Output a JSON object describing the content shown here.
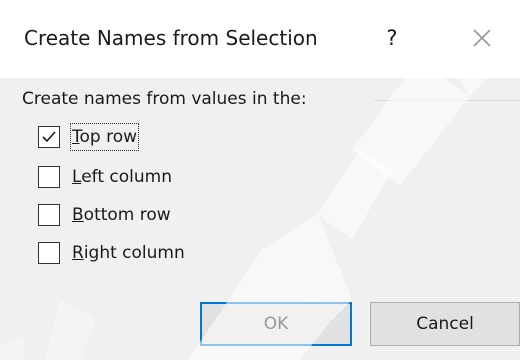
{
  "dialog": {
    "title": "Create Names from Selection",
    "help_label": "?",
    "close_icon": "close-icon"
  },
  "group": {
    "label": "Create names from values in the:"
  },
  "options": [
    {
      "mnemonic": "T",
      "rest": "op row",
      "checked": true
    },
    {
      "mnemonic": "L",
      "rest": "eft column",
      "checked": false
    },
    {
      "mnemonic": "B",
      "rest": "ottom row",
      "checked": false
    },
    {
      "mnemonic": "R",
      "rest": "ight column",
      "checked": false
    }
  ],
  "buttons": {
    "ok_label": "OK",
    "cancel_label": "Cancel"
  },
  "colors": {
    "accent": "#0078d7",
    "watermark": "#ffffff"
  }
}
